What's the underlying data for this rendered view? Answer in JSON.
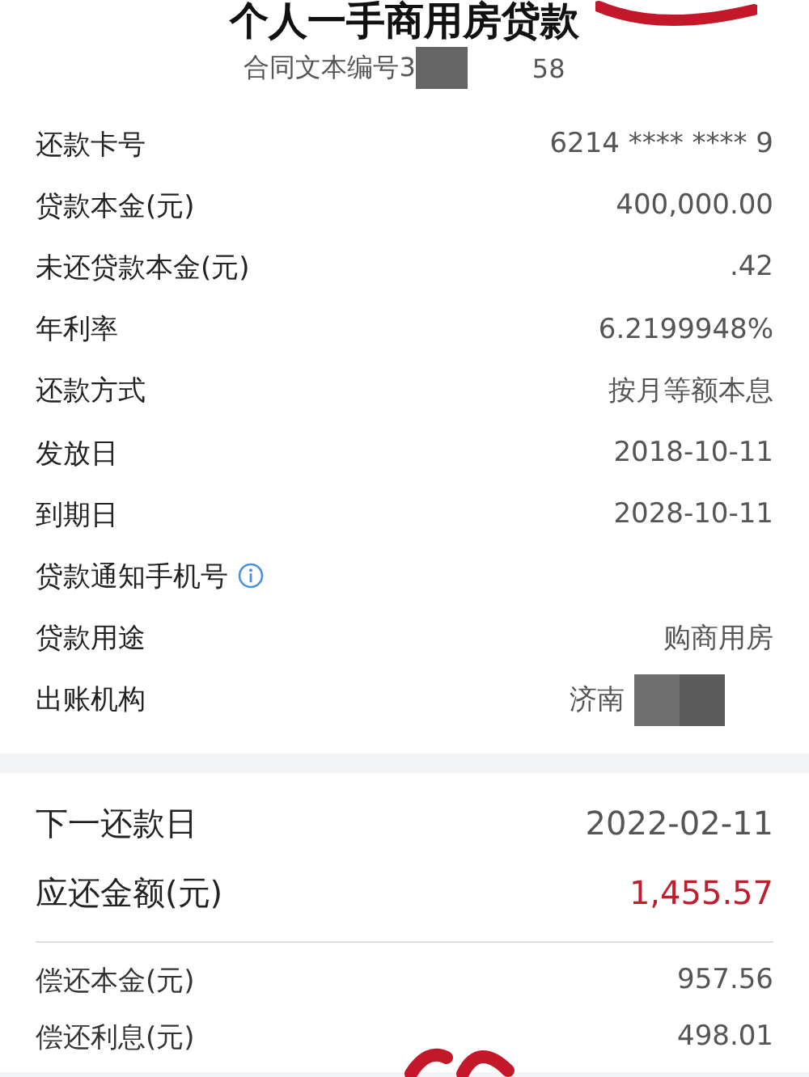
{
  "header": {
    "title": "个人一手商用房贷款",
    "contract_prefix": "合同文本编号3",
    "contract_suffix": "58",
    "redacted": true
  },
  "details": [
    {
      "label": "还款卡号",
      "value": "6214 **** **** 9"
    },
    {
      "label": "贷款本金(元)",
      "value": "400,000.00"
    },
    {
      "label": "未还贷款本金(元)",
      "value": ".42"
    },
    {
      "label": "年利率",
      "value": "6.2199948%"
    },
    {
      "label": "还款方式",
      "value": "按月等额本息"
    },
    {
      "label": "发放日",
      "value": "2018-10-11"
    },
    {
      "label": "到期日",
      "value": "2028-10-11"
    },
    {
      "label": "贷款通知手机号",
      "info": true
    },
    {
      "label": "贷款用途",
      "value": "购商用房"
    },
    {
      "label": "出账机构",
      "value": "济南",
      "redacted": true
    }
  ],
  "next_payment": {
    "date_label": "下一还款日",
    "date": "2022-02-11",
    "amount_label": "应还金额(元)",
    "amount": "1,455.57"
  },
  "breakdown": [
    {
      "label": "偿还本金(元)",
      "value": "957.56"
    },
    {
      "label": "偿还利息(元)",
      "value": "498.01"
    }
  ]
}
